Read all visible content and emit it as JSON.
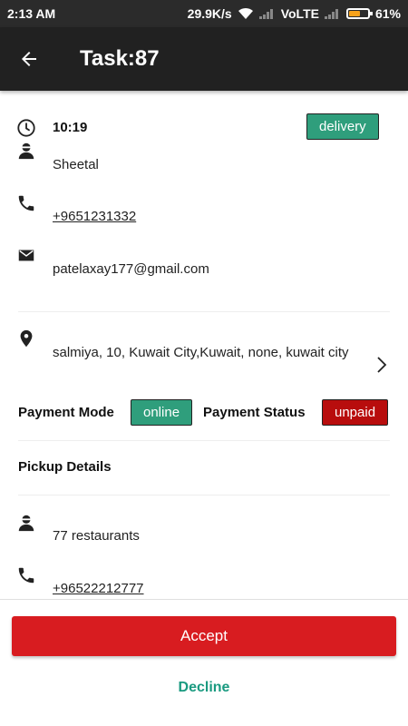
{
  "status_bar": {
    "time": "2:13 AM",
    "network_speed": "29.9K/s",
    "network_type": "VoLTE",
    "battery_percent": "61%",
    "battery_level": 0.61
  },
  "app_bar": {
    "title": "Task:87",
    "back_icon": "arrow-left-icon"
  },
  "task": {
    "time": "10:19",
    "type_badge": "delivery",
    "customer_name": "Sheetal",
    "phone": "+9651231332",
    "email": "patelaxay177@gmail.com",
    "address": "salmiya, 10, Kuwait City,Kuwait, none, kuwait city"
  },
  "payment": {
    "mode_label": "Payment Mode",
    "mode_value": "online",
    "status_label": "Payment Status",
    "status_value": "unpaid"
  },
  "pickup": {
    "heading": "Pickup Details",
    "name": "77 restaurants",
    "phone": "+96522212777"
  },
  "actions": {
    "accept": "Accept",
    "decline": "Decline"
  },
  "colors": {
    "accent_green": "#2f9e7c",
    "unpaid_red": "#b80d0d",
    "accept_red": "#d81c20",
    "decline_teal": "#1a9a80",
    "app_bar": "#212121"
  }
}
